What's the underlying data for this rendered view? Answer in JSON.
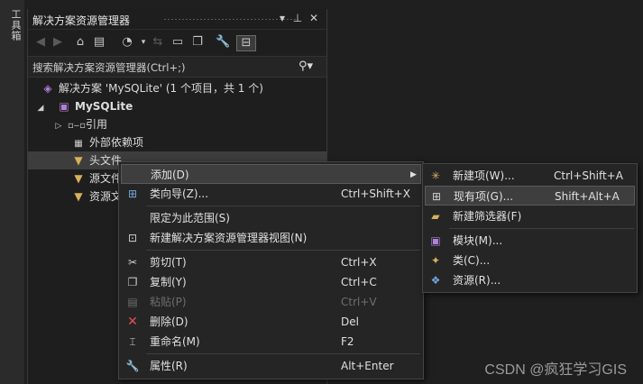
{
  "toolbox": {
    "label": "工具箱"
  },
  "panel": {
    "title": "解决方案资源管理器",
    "title_buttons": [
      "▾",
      "⊥",
      "✕"
    ]
  },
  "search": {
    "placeholder": "搜索解决方案资源管理器(Ctrl+;)"
  },
  "tree": [
    {
      "label": "解决方案 'MySQLite' (1 个项目，共 1 个)",
      "icon": "solution-icon"
    },
    {
      "label": "MySQLite",
      "icon": "project-icon",
      "expanded": true
    },
    {
      "label": "引用",
      "icon": "references-icon",
      "collapsed": true
    },
    {
      "label": "外部依赖项",
      "icon": "external-deps-icon"
    },
    {
      "label": "头文件",
      "icon": "filter-folder-icon",
      "selected": true
    },
    {
      "label": "源文件",
      "icon": "filter-folder-icon"
    },
    {
      "label": "资源文件",
      "icon": "filter-folder-icon"
    }
  ],
  "context_menu": {
    "items": [
      {
        "label": "添加(D)",
        "shortcut": "",
        "submenu": true,
        "icon": ""
      },
      {
        "label": "类向导(Z)...",
        "shortcut": "Ctrl+Shift+X",
        "icon": "class-wizard-icon"
      },
      {
        "label": "限定为此范围(S)",
        "shortcut": "",
        "icon": ""
      },
      {
        "label": "新建解决方案资源管理器视图(N)",
        "shortcut": "",
        "icon": "new-view-icon"
      },
      {
        "label": "剪切(T)",
        "shortcut": "Ctrl+X",
        "icon": "cut-icon"
      },
      {
        "label": "复制(Y)",
        "shortcut": "Ctrl+C",
        "icon": "copy-icon"
      },
      {
        "label": "粘贴(P)",
        "shortcut": "Ctrl+V",
        "icon": "paste-icon",
        "disabled": true
      },
      {
        "label": "删除(D)",
        "shortcut": "Del",
        "icon": "delete-icon"
      },
      {
        "label": "重命名(M)",
        "shortcut": "F2",
        "icon": "rename-icon"
      },
      {
        "label": "属性(R)",
        "shortcut": "Alt+Enter",
        "icon": "properties-icon"
      }
    ]
  },
  "submenu": {
    "items": [
      {
        "label": "新建项(W)...",
        "shortcut": "Ctrl+Shift+A",
        "icon": "new-item-icon"
      },
      {
        "label": "现有项(G)...",
        "shortcut": "Shift+Alt+A",
        "icon": "existing-item-icon",
        "highlight": true
      },
      {
        "label": "新建筛选器(F)",
        "shortcut": "",
        "icon": "new-filter-icon"
      },
      {
        "label": "模块(M)...",
        "shortcut": "",
        "icon": "module-icon"
      },
      {
        "label": "类(C)...",
        "shortcut": "",
        "icon": "class-icon"
      },
      {
        "label": "资源(R)...",
        "shortcut": "",
        "icon": "resource-icon"
      }
    ]
  },
  "watermark": "CSDN @疯狂学习GIS",
  "colors": {
    "background": "#1f1f1f",
    "menu": "#252526",
    "highlight": "#3e3e3e",
    "delete_red": "#e05252"
  }
}
